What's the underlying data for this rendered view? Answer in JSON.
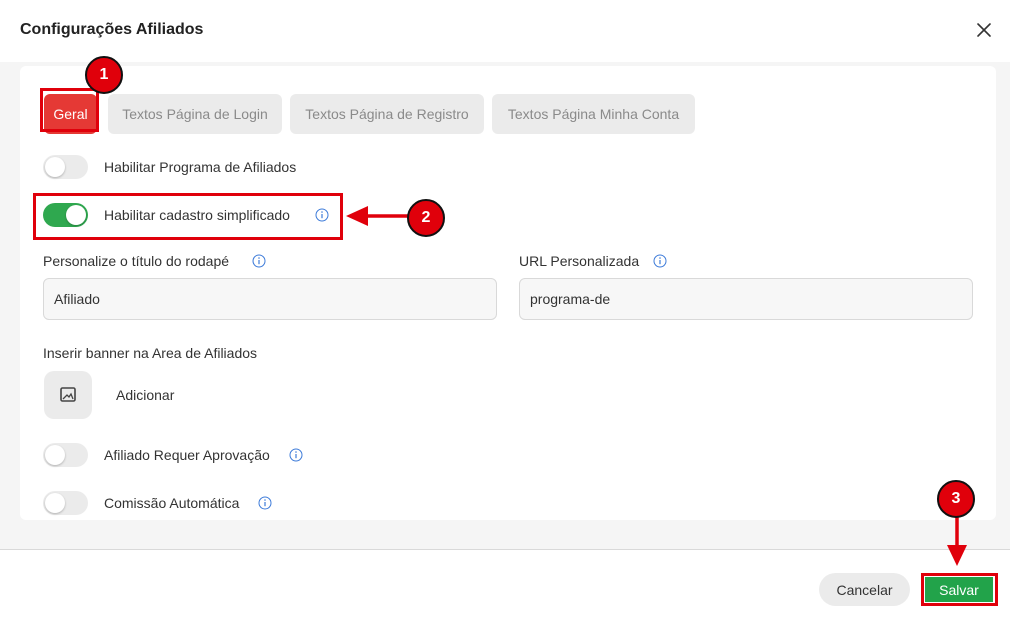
{
  "modal": {
    "title": "Configurações Afiliados"
  },
  "tabs": [
    {
      "label": "Geral",
      "active": true
    },
    {
      "label": "Textos Página de Login",
      "active": false
    },
    {
      "label": "Textos Página de Registro",
      "active": false
    },
    {
      "label": "Textos Página Minha Conta",
      "active": false
    }
  ],
  "settings": {
    "enable_program": {
      "label": "Habilitar Programa de Afiliados",
      "on": false
    },
    "simplified_signup": {
      "label": "Habilitar cadastro simplificado",
      "on": true
    },
    "footer_title": {
      "label": "Personalize o título do rodapé",
      "value": "Afiliado"
    },
    "custom_url": {
      "label": "URL Personalizada",
      "value": "programa-de"
    },
    "banner": {
      "label": "Inserir banner na Area de Afiliados",
      "add_label": "Adicionar"
    },
    "requires_approval": {
      "label": "Afiliado Requer Aprovação",
      "on": false
    },
    "auto_commission": {
      "label": "Comissão Automática",
      "on": false
    }
  },
  "footer": {
    "cancel_label": "Cancelar",
    "save_label": "Salvar"
  },
  "annotations": {
    "step1": "1",
    "step2": "2",
    "step3": "3"
  },
  "colors": {
    "accent_red": "#e53935",
    "toggle_on": "#2fa84f",
    "save_green": "#22a34a",
    "annotation_red": "#e0000b",
    "info_blue": "#3d7bd9"
  }
}
